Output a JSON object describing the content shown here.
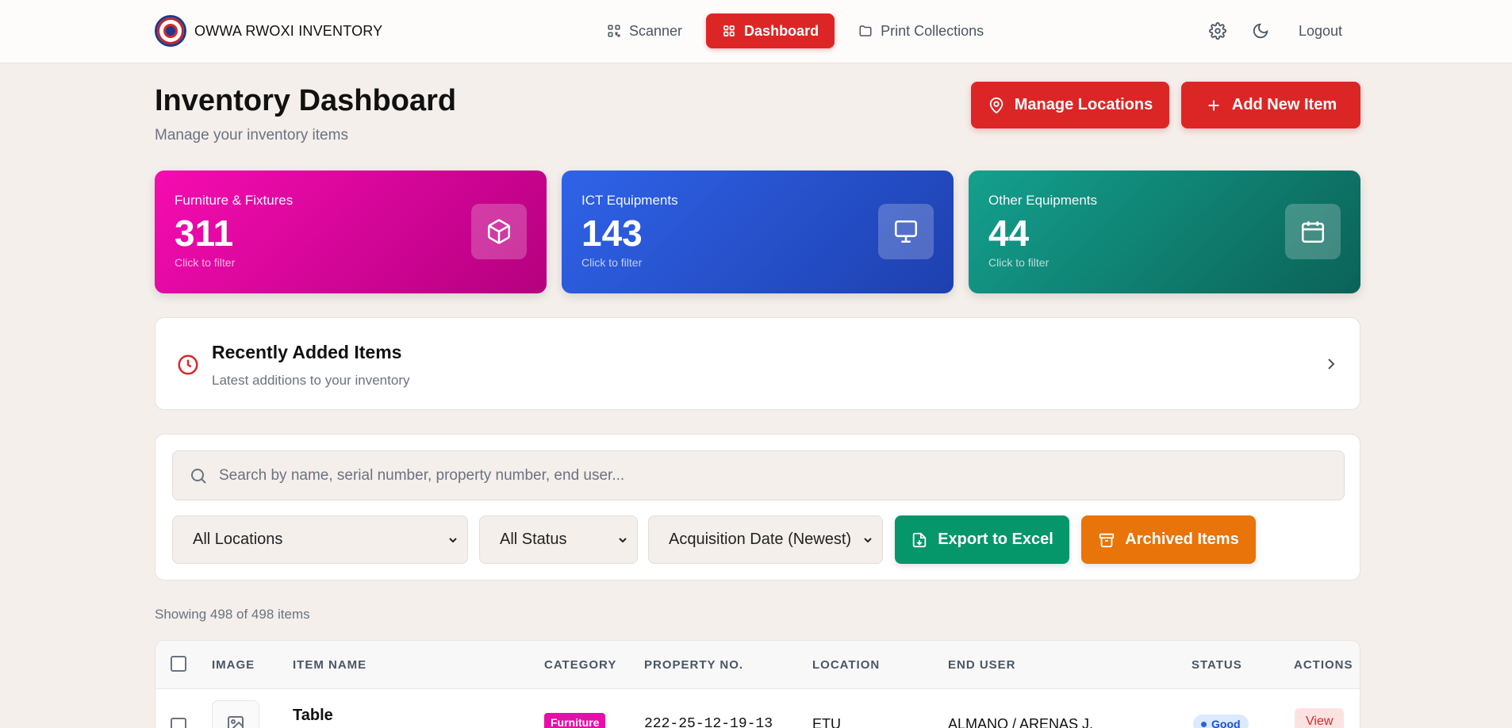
{
  "brand": {
    "name": "OWWA RWOXI INVENTORY"
  },
  "nav": {
    "items": [
      {
        "label": "Scanner",
        "icon": "qr-scan-icon"
      },
      {
        "label": "Dashboard",
        "icon": "grid-icon",
        "active": true
      },
      {
        "label": "Print Collections",
        "icon": "folder-icon"
      }
    ],
    "logout_label": "Logout"
  },
  "header": {
    "title": "Inventory Dashboard",
    "subtitle": "Manage your inventory items",
    "manage_locations_label": "Manage Locations",
    "add_item_label": "Add New Item"
  },
  "stats": [
    {
      "label": "Furniture & Fixtures",
      "count": "311",
      "hint": "Click to filter",
      "icon": "box-icon",
      "color": "#e60fa7"
    },
    {
      "label": "ICT Equipments",
      "count": "143",
      "hint": "Click to filter",
      "icon": "monitor-icon",
      "color": "#2563eb"
    },
    {
      "label": "Other Equipments",
      "count": "44",
      "hint": "Click to filter",
      "icon": "calendar-icon",
      "color": "#0f9488"
    }
  ],
  "recent": {
    "title": "Recently Added Items",
    "subtitle": "Latest additions to your inventory"
  },
  "filters": {
    "search_placeholder": "Search by name, serial number, property number, end user...",
    "location": "All Locations",
    "status": "All Status",
    "sort": "Acquisition Date (Newest)",
    "export_label": "Export to Excel",
    "archived_label": "Archived Items",
    "colors": {
      "export": "#059669",
      "archived": "#e8740a"
    }
  },
  "showing_text": "Showing 498 of 498 items",
  "table": {
    "columns": [
      "IMAGE",
      "ITEM NAME",
      "CATEGORY",
      "PROPERTY NO.",
      "LOCATION",
      "END USER",
      "STATUS",
      "ACTIONS"
    ],
    "rows": [
      {
        "name": "Table",
        "category": "Furniture",
        "property_no": "222-25-12-19-13",
        "location": "ETU",
        "end_user": "ALMANO / ARENAS J.",
        "status": "Good",
        "action": "View"
      }
    ]
  },
  "accent": "#dc2626"
}
